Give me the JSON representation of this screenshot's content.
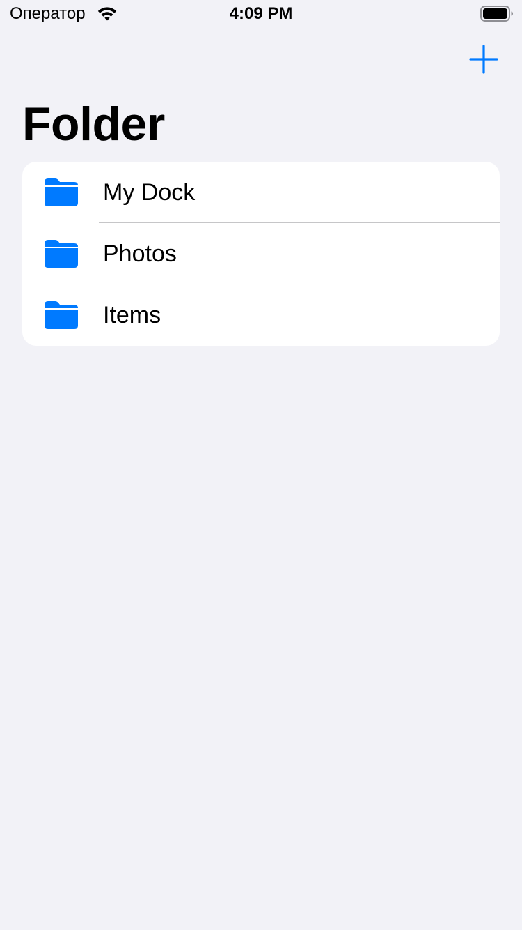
{
  "status_bar": {
    "carrier": "Оператор",
    "time": "4:09 PM",
    "wifi_icon": "wifi-icon",
    "battery_icon": "battery-icon"
  },
  "nav": {
    "add_icon": "plus-icon",
    "title": "Folder"
  },
  "colors": {
    "accent": "#007AFF",
    "background": "#F2F2F7",
    "card": "#FFFFFF",
    "separator": "#C6C6C8"
  },
  "folders": [
    {
      "label": "My Dock",
      "icon": "folder-icon"
    },
    {
      "label": "Photos",
      "icon": "folder-icon"
    },
    {
      "label": "Items",
      "icon": "folder-icon"
    }
  ]
}
